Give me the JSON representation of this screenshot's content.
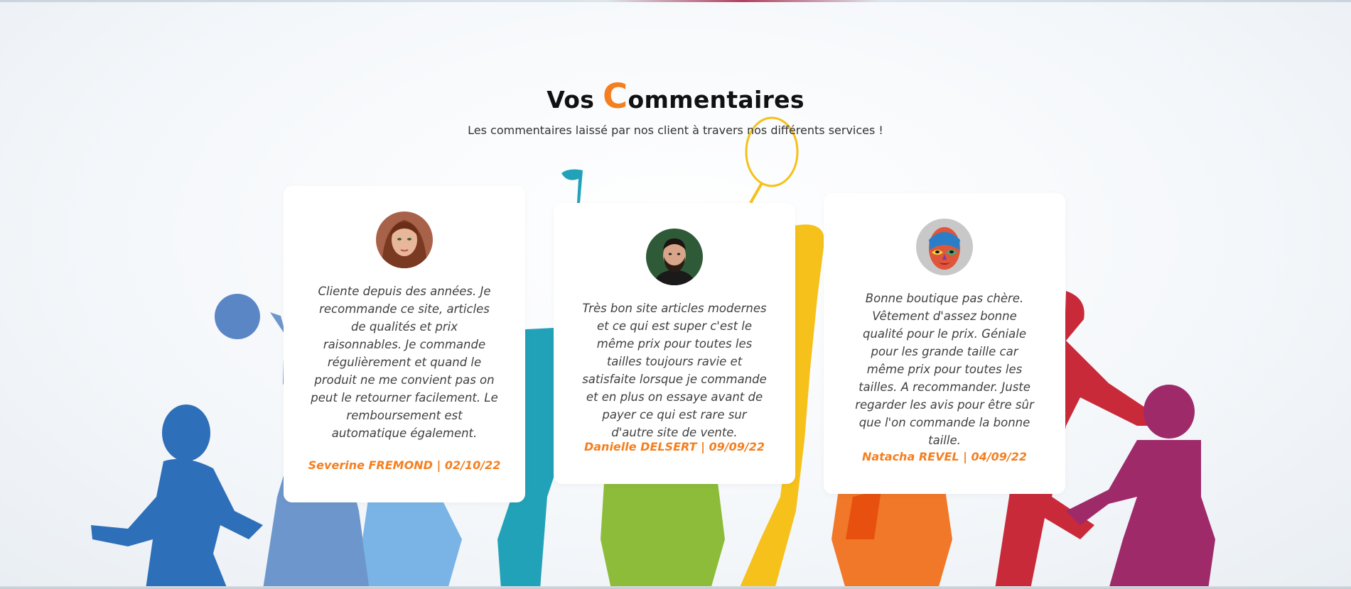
{
  "section": {
    "title_first": "Vos",
    "title_accent_letter": "C",
    "title_rest": "ommentaires",
    "subtitle": "Les commentaires laissé par nos client à travers nos différents services !"
  },
  "testimonials": [
    {
      "avatar_icon": "woman-portrait",
      "comment": "Cliente depuis des années. Je recommande ce site, articles de qualités et prix raisonnables. Je commande régulièrement et quand le produit ne me convient pas on peut le retourner facilement. Le remboursement est automatique également.",
      "author": "Severine FREMOND | 02/10/22"
    },
    {
      "avatar_icon": "bearded-man-portrait",
      "comment": "Très bon site articles modernes et ce qui est super c'est le même prix pour toutes les tailles toujours ravie et satisfaite lorsque je commande et en plus on essaye avant de payer ce qui est rare sur d'autre site de vente.",
      "author": "Danielle DELSERT | 09/09/22"
    },
    {
      "avatar_icon": "painted-face-portrait",
      "comment": "Bonne boutique pas chère. Vêtement d'assez bonne qualité pour le prix. Géniale pour les grande taille car même prix pour toutes les tailles. A recommander. Juste regarder les avis pour être sûr que l'on commande la bonne taille.",
      "author": "Natacha REVEL | 04/09/22"
    }
  ],
  "colors": {
    "accent": "#f47f20",
    "title": "#111111",
    "comment_text": "#404040",
    "card_background": "#ffffff"
  }
}
